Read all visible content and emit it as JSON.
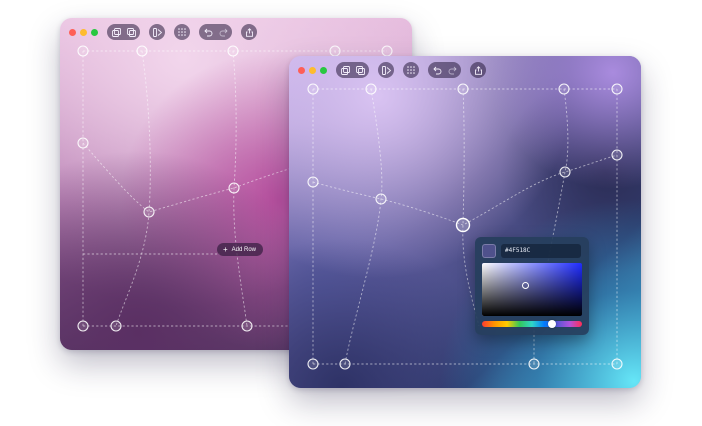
{
  "back_window": {
    "add_row_label": "Add Row",
    "background_colors": [
      "#f0cde6",
      "#d89ad0",
      "#b65ca8",
      "#6a3d6e",
      "#46284e",
      "#7a4c7e"
    ]
  },
  "front_window": {
    "background_colors": [
      "#d6b8ee",
      "#9d84d8",
      "#4a4a84",
      "#333567",
      "#2b5f93",
      "#66dff2"
    ],
    "color_picker": {
      "hex_value": "#4F518C",
      "swatch_color": "#4F518C",
      "base_hue_color": "#1f2cff"
    }
  },
  "traffic_light_colors": {
    "close": "#fe5f57",
    "minimize": "#febc2e",
    "zoom": "#28c840"
  },
  "toolbar_icons": [
    "duplicate-icon",
    "copy-icon",
    "layers-icon",
    "grid-icon",
    "undo-icon",
    "redo-icon",
    "share-icon"
  ]
}
